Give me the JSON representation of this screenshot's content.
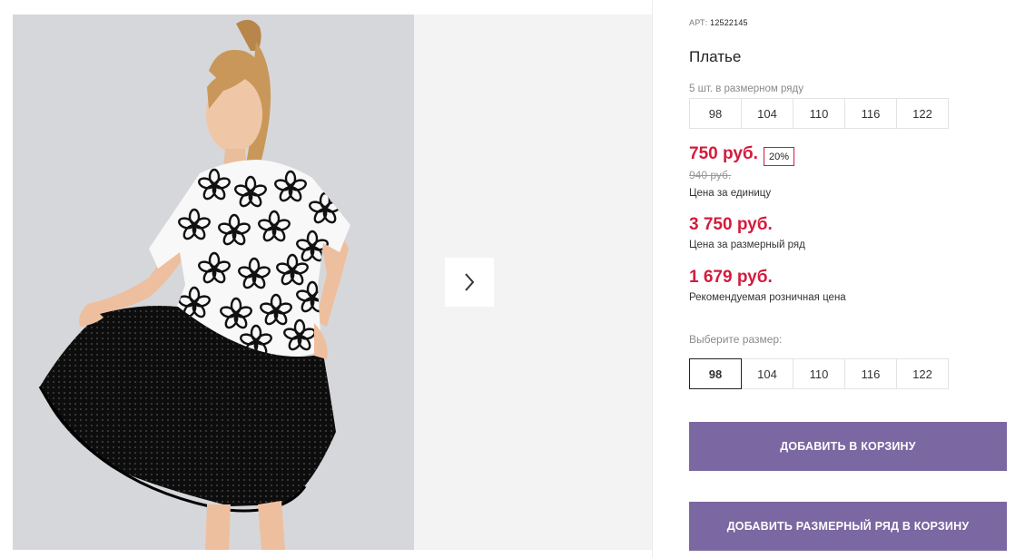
{
  "product": {
    "sku_label": "АРТ:",
    "sku": "12522145",
    "title": "Платье",
    "pack_note": "5 шт. в размерном ряду",
    "pack_sizes": [
      "98",
      "104",
      "110",
      "116",
      "122"
    ]
  },
  "pricing": {
    "unit_price": "750 руб.",
    "discount": "20%",
    "old_price": "940 руб.",
    "unit_caption": "Цена за единицу",
    "row_price": "3 750 руб.",
    "row_caption": "Цена за размерный ряд",
    "rrp_price": "1 679 руб.",
    "rrp_caption": "Рекомендуемая розничная цена"
  },
  "size_select": {
    "label": "Выберите размер:",
    "options": [
      "98",
      "104",
      "110",
      "116",
      "122"
    ],
    "selected": "98"
  },
  "actions": {
    "add_to_cart": "ДОБАВИТЬ В КОРЗИНУ",
    "add_row_to_cart": "ДОБАВИТЬ РАЗМЕРНЫЙ РЯД В КОРЗИНУ"
  },
  "gallery": {
    "next_icon": "chevron-right-icon"
  },
  "colors": {
    "price_accent": "#d41b3c",
    "button_bg": "#7b67a1"
  }
}
